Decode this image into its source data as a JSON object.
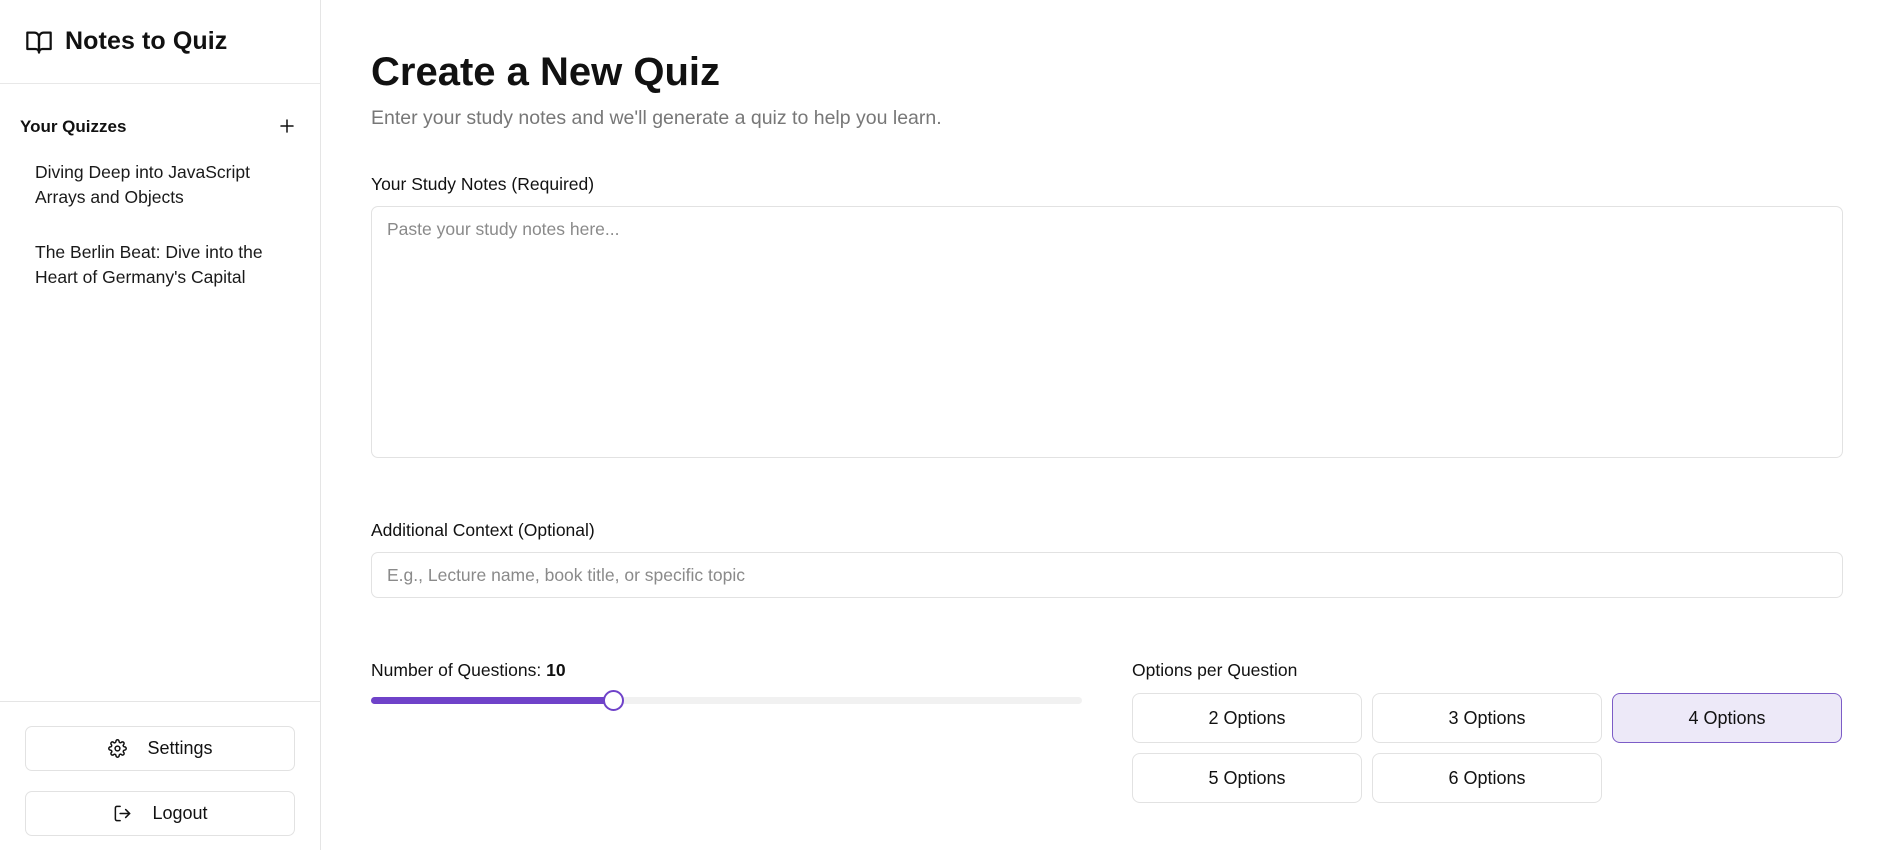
{
  "app": {
    "title": "Notes to Quiz",
    "accent": "#6f42c9"
  },
  "sidebar": {
    "section_title": "Your Quizzes",
    "quizzes": [
      {
        "title": "Diving Deep into JavaScript Arrays and Objects"
      },
      {
        "title": "The Berlin Beat: Dive into the Heart of Germany's Capital"
      }
    ],
    "settings_label": "Settings",
    "logout_label": "Logout"
  },
  "main": {
    "title": "Create a New Quiz",
    "subtitle": "Enter your study notes and we'll generate a quiz to help you learn.",
    "notes": {
      "label": "Your Study Notes (Required)",
      "placeholder": "Paste your study notes here...",
      "value": ""
    },
    "context": {
      "label": "Additional Context (Optional)",
      "placeholder": "E.g., Lecture name, book title, or specific topic",
      "value": ""
    },
    "questions": {
      "label": "Number of Questions:",
      "value": "10",
      "slider_fraction": 0.34
    },
    "options": {
      "label": "Options per Question",
      "items": [
        "2 Options",
        "3 Options",
        "4 Options",
        "5 Options",
        "6 Options"
      ],
      "selected": "4 Options"
    }
  }
}
